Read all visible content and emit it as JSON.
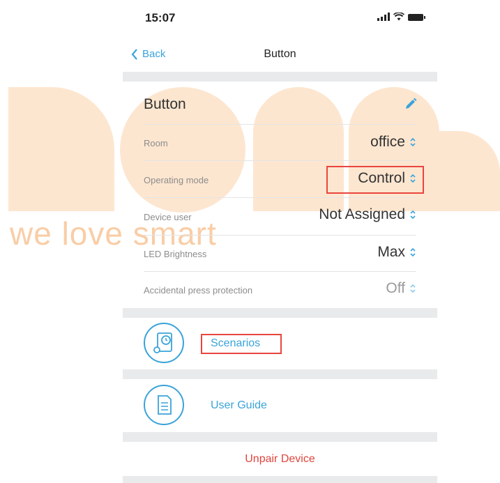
{
  "watermark": {
    "tagline": "we love smart"
  },
  "status_bar": {
    "time": "15:07"
  },
  "nav": {
    "back_label": "Back",
    "title": "Button"
  },
  "device": {
    "name": "Button"
  },
  "settings": [
    {
      "label": "Room",
      "value": "office"
    },
    {
      "label": "Operating mode",
      "value": "Control"
    },
    {
      "label": "Device user",
      "value": "Not Assigned"
    },
    {
      "label": "LED Brightness",
      "value": "Max"
    },
    {
      "label": "Accidental press protection",
      "value": "Off"
    }
  ],
  "actions": {
    "scenarios_label": "Scenarios",
    "user_guide_label": "User Guide",
    "unpair_label": "Unpair Device"
  },
  "colors": {
    "accent": "#3aa3da",
    "danger": "#e0443d",
    "highlight": "#e9453e",
    "watermark": "#fde6d0"
  }
}
